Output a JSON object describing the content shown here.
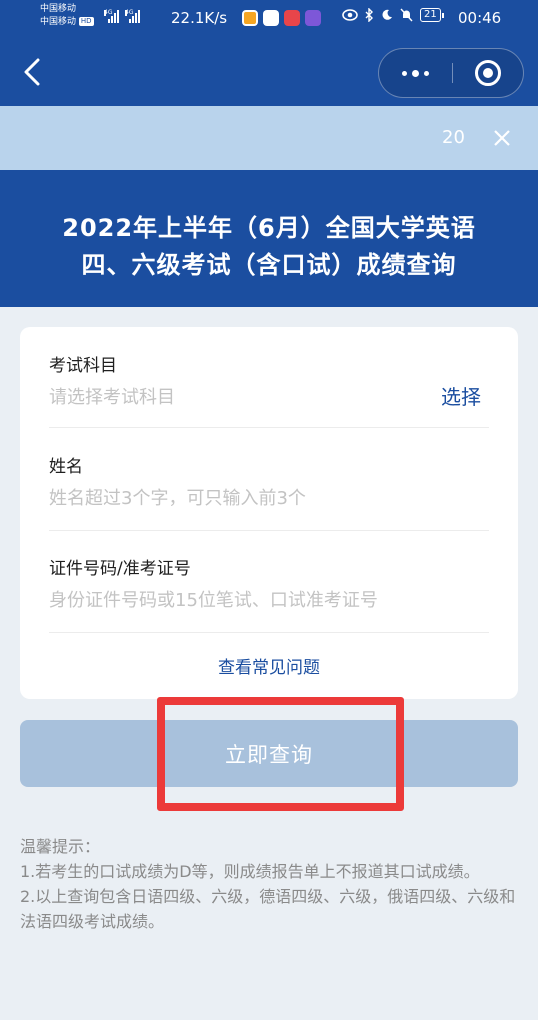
{
  "status_bar": {
    "carrier_1": "中国移动",
    "carrier_2": "中国移动",
    "hd_badge": "HD",
    "network_1": "4G",
    "network_2": "4G",
    "net_speed": "22.1K/s",
    "battery": "21",
    "time": "00:46",
    "app_icons": [
      "weibo-icon",
      "mail-icon",
      "video-app-icon",
      "music-app-icon"
    ],
    "system_icons": [
      "eye-icon",
      "bluetooth-icon",
      "moon-icon",
      "bell-muted-icon"
    ]
  },
  "nav": {
    "back_icon": "chevron-left-icon",
    "more_icon": "more-dots-icon",
    "close_icon": "target-close-icon"
  },
  "notice": {
    "countdown": "20",
    "close_icon": "close-x-icon"
  },
  "hero": {
    "title_line1": "2022年上半年（6月）全国大学英语",
    "title_line2": "四、六级考试（含口试）成绩查询"
  },
  "form": {
    "subject": {
      "label": "考试科目",
      "placeholder": "请选择考试科目",
      "action": "选择"
    },
    "name": {
      "label": "姓名",
      "placeholder": "姓名超过3个字，可只输入前3个"
    },
    "id_number": {
      "label": "证件号码/准考证号",
      "placeholder": "身份证件号码或15位笔试、口试准考证号"
    },
    "faq_link": "查看常见问题"
  },
  "submit_label": "立即查询",
  "tips": {
    "heading": "温馨提示：",
    "item1": "1.若考生的口试成绩为D等，则成绩报告单上不报道其口试成绩。",
    "item2": "2.以上查询包含日语四级、六级，德语四级、六级，俄语四级、六级和法语四级考试成绩。"
  },
  "colors": {
    "brand_blue": "#1b4ea0",
    "notice_bg": "#b9d3ec",
    "button_disabled": "#a8c1dc",
    "highlight_red": "#ec3a39",
    "page_bg": "#eaeff4"
  }
}
